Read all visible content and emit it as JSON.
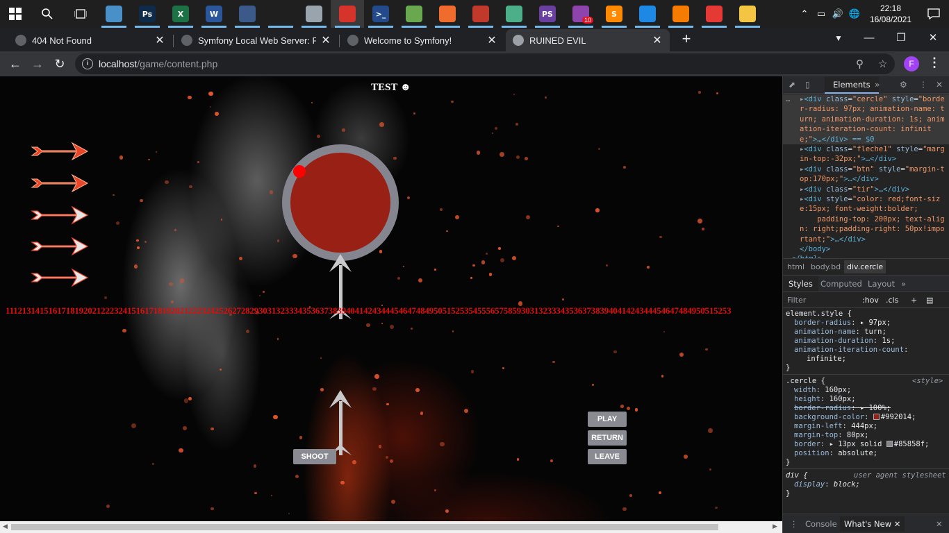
{
  "taskbar": {
    "apps": [
      {
        "name": "search-icon",
        "label": "",
        "color": ""
      },
      {
        "name": "task-view-icon",
        "label": "",
        "color": ""
      },
      {
        "name": "app-icon",
        "label": "",
        "color": "#4a90c8"
      },
      {
        "name": "photoshop-icon",
        "label": "Ps",
        "color": "#0f2b4a"
      },
      {
        "name": "excel-icon",
        "label": "X",
        "color": "#1d7245"
      },
      {
        "name": "word-icon",
        "label": "W",
        "color": "#2b579a"
      },
      {
        "name": "pen-tool-icon",
        "label": "",
        "color": "#3b5a8a"
      },
      {
        "name": "flame-app-icon",
        "label": "",
        "color": "#1f1f1f"
      },
      {
        "name": "robot-app-icon",
        "label": "",
        "color": "#9aa4ad"
      },
      {
        "name": "red-app-icon",
        "label": "",
        "color": "#d6332b"
      },
      {
        "name": "powershell-icon",
        "label": ">_",
        "color": "#234a8a"
      },
      {
        "name": "nodejs-icon",
        "label": "",
        "color": "#6aa84f"
      },
      {
        "name": "postman-icon",
        "label": "",
        "color": "#ef6c2c"
      },
      {
        "name": "git-icon",
        "label": "",
        "color": "#c0392b"
      },
      {
        "name": "atom-icon",
        "label": "",
        "color": "#4caf8a"
      },
      {
        "name": "phpstorm-icon",
        "label": "PS",
        "color": "#6b3fa0"
      },
      {
        "name": "messenger-icon",
        "label": "",
        "color": "#8e44ad",
        "badge": "10"
      },
      {
        "name": "sublime-icon",
        "label": "S",
        "color": "#ff8a00"
      },
      {
        "name": "vscode-icon",
        "label": "",
        "color": "#1e88e5"
      },
      {
        "name": "xampp-icon",
        "label": "",
        "color": "#f57c00"
      },
      {
        "name": "chrome-icon",
        "label": "",
        "color": "#e53935"
      },
      {
        "name": "file-explorer-icon",
        "label": "",
        "color": "#f4c542"
      }
    ],
    "time": "22:18",
    "date": "16/08/2021"
  },
  "tabs": [
    {
      "title": "404 Not Found"
    },
    {
      "title": "Symfony Local Web Server: Page"
    },
    {
      "title": "Welcome to Symfony!"
    },
    {
      "title": "RUINED EVIL"
    }
  ],
  "address": {
    "host": "localhost",
    "path": "/game/content.php",
    "profile_initial": "F"
  },
  "page": {
    "title": "TEST ☻",
    "numbers": "1112131415161718192021222324151617181920212223242526272829303132333435363738394041424344454647484950515253545556575859303132333435363738394041424344454647484950515253",
    "buttons": {
      "play": "PLAY",
      "return": "RETURN",
      "leave": "LEAVE",
      "shoot": "SHOOT"
    },
    "colors": {
      "circle": "#992014",
      "circle_border": "#85858f",
      "dot": "#ff0000",
      "numbers": "#e00d0d"
    }
  },
  "devtools": {
    "tab_elements": "Elements",
    "dom": [
      {
        "pre": "▸",
        "tag": "div",
        "attrs": [
          [
            "class",
            "cercle"
          ],
          [
            "style",
            "border-radius: 97px; animation-name: turn; animation-duration: 1s; animation-iteration-count: infinite;"
          ]
        ],
        "post": "…</div> == $0"
      },
      {
        "pre": "▸",
        "tag": "div",
        "attrs": [
          [
            "class",
            "fleche1"
          ],
          [
            "style",
            "margin-top:-32px;"
          ]
        ],
        "post": "…</div>"
      },
      {
        "pre": "▸",
        "tag": "div",
        "attrs": [
          [
            "class",
            "btn"
          ],
          [
            "style",
            "margin-top:170px;"
          ]
        ],
        "post": "…</div>"
      },
      {
        "pre": "▸",
        "tag": "div",
        "attrs": [
          [
            "class",
            "tir"
          ]
        ],
        "post": "…</div>"
      },
      {
        "pre": "▸",
        "tag": "div",
        "attrs": [
          [
            "style",
            "color: red;font-size:15px; font-weight:bolder;\n    padding-top: 200px; text-align: right;padding-right: 50px!important;"
          ]
        ],
        "post": "…</div>"
      },
      {
        "pre": "",
        "tag": "",
        "attrs": [],
        "post": "</body>"
      },
      {
        "pre": "",
        "tag": "",
        "attrs": [],
        "post": "</html>"
      }
    ],
    "breadcrumbs": [
      "html",
      "body.bd",
      "div.cercle"
    ],
    "sub_tabs": [
      "Styles",
      "Computed",
      "Layout",
      "»"
    ],
    "filter_placeholder": "Filter",
    "filter_hov": ":hov",
    "filter_cls": ".cls",
    "element_style": {
      "selector": "element.style {",
      "props": [
        {
          "name": "border-radius",
          "value": "▸ 97px;"
        },
        {
          "name": "animation-name",
          "value": "turn;"
        },
        {
          "name": "animation-duration",
          "value": "1s;"
        },
        {
          "name": "animation-iteration-count",
          "value": ""
        },
        {
          "name": "",
          "value": "infinite;"
        }
      ]
    },
    "cercle_rule": {
      "selector": ".cercle {",
      "source": "<style>",
      "props": [
        {
          "name": "width",
          "value": "160px;",
          "struck": false
        },
        {
          "name": "height",
          "value": "160px;",
          "struck": false
        },
        {
          "name": "border-radius",
          "value": "▸ 100%;",
          "struck": true
        },
        {
          "name": "background-color",
          "value": "#992014;",
          "swatch": "#992014",
          "struck": false
        },
        {
          "name": "margin-left",
          "value": "444px;",
          "struck": false
        },
        {
          "name": "margin-top",
          "value": "80px;",
          "struck": false
        },
        {
          "name": "border",
          "value": "▸ 13px solid #85858f;",
          "swatch": "#85858f",
          "struck": false
        },
        {
          "name": "position",
          "value": "absolute;",
          "struck": false
        }
      ]
    },
    "ua_rule": {
      "selector": "div {",
      "source": "user agent stylesheet",
      "props": [
        {
          "name": "display",
          "value": "block;"
        }
      ]
    },
    "drawer": {
      "console": "Console",
      "whats_new": "What's New"
    }
  }
}
